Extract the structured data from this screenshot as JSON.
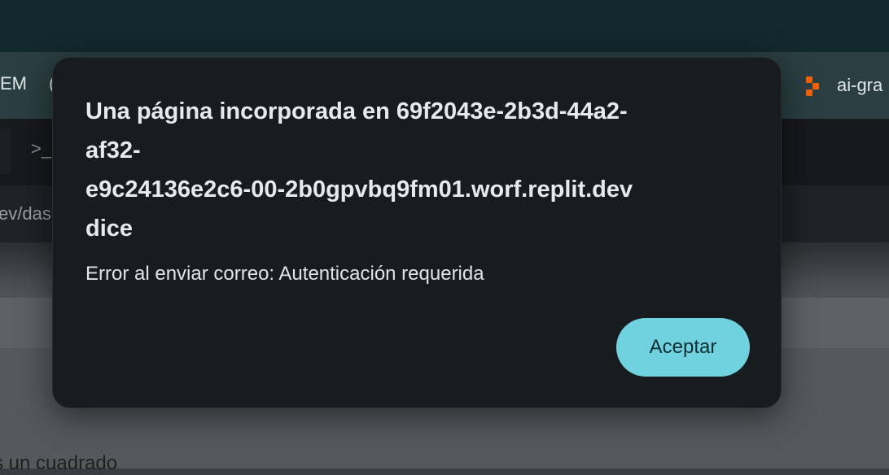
{
  "browser": {
    "left_tab_label": "EM",
    "left_tab_mark": "(",
    "right_tab_label": "ai-gra",
    "right_tab_icon": "replit-logo-icon",
    "toolbar_icon": "terminal-prompt-icon",
    "toolbar_icon_glyph": ">_",
    "url_fragment": "ev/das"
  },
  "page": {
    "text": "s un cuadrado"
  },
  "dialog": {
    "title_lines": [
      "Una página incorporada en 69f2043e-2b3d-44a2-",
      "af32-",
      "e9c24136e2c6-00-2b0gpvbq9fm01.worf.replit.dev",
      "dice"
    ],
    "message": "Error al enviar correo: Autenticación requerida",
    "accept_label": "Aceptar"
  },
  "colors": {
    "dialog_bg": "#181c1f",
    "accent_button": "#6fd2de",
    "replit_orange": "#f26207"
  }
}
